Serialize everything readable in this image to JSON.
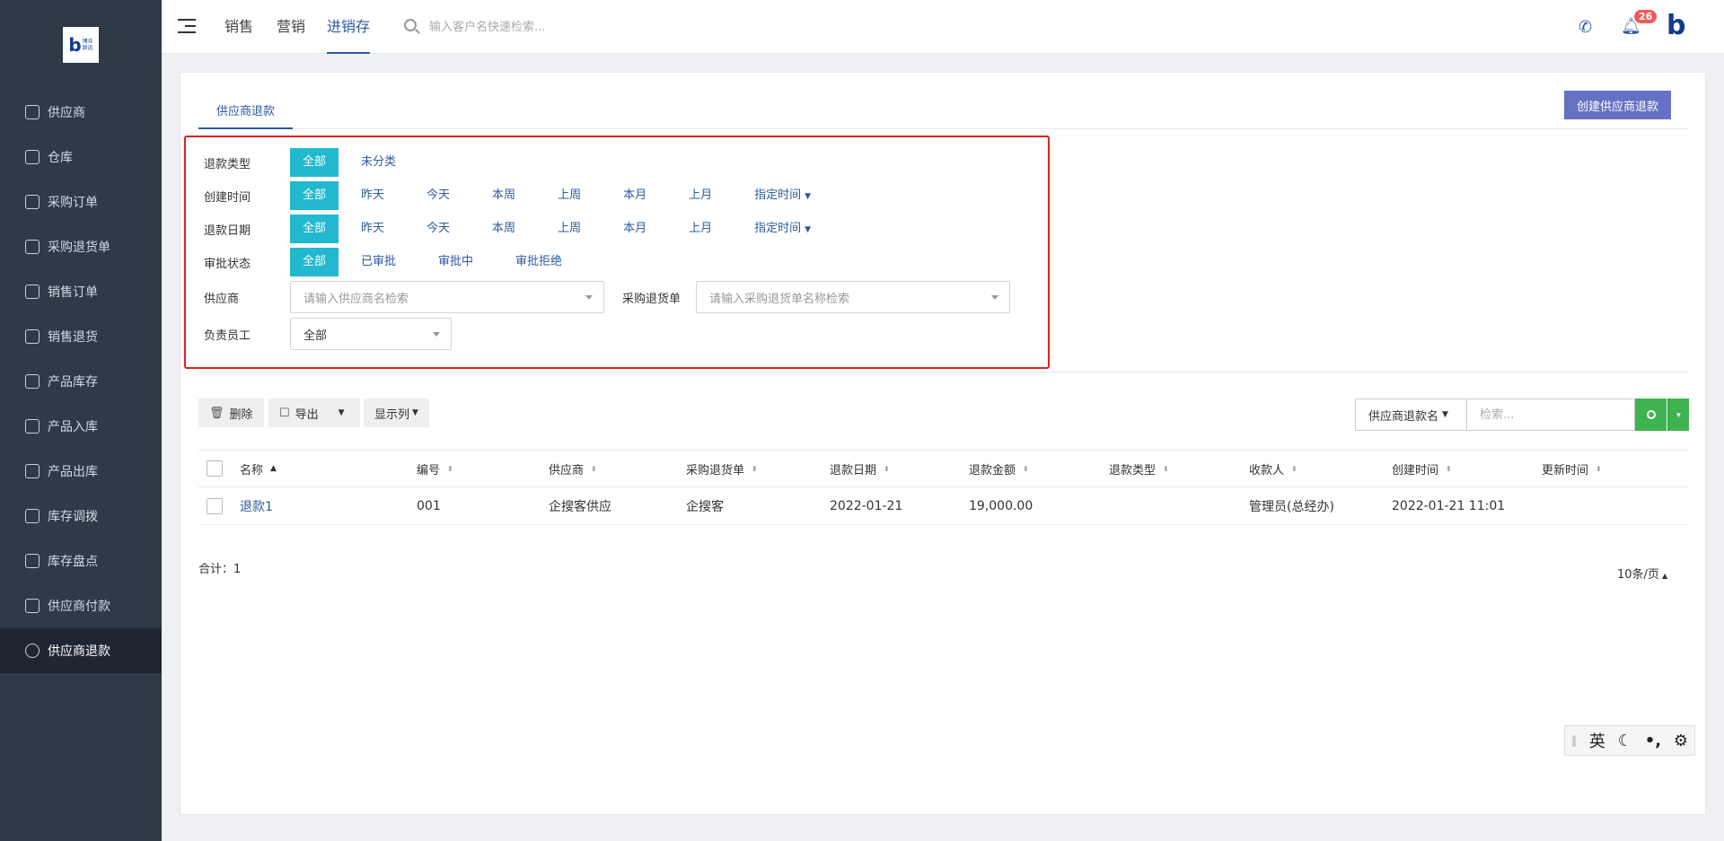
{
  "logo": {
    "letter": "b",
    "text": "博众\n致远"
  },
  "sidebar": {
    "items": [
      {
        "label": "供应商",
        "icon": "store-icon"
      },
      {
        "label": "仓库",
        "icon": "warehouse-icon"
      },
      {
        "label": "采购订单",
        "icon": "cart-icon"
      },
      {
        "label": "采购退货单",
        "icon": "cart-return-icon"
      },
      {
        "label": "销售订单",
        "icon": "document-icon"
      },
      {
        "label": "销售退货",
        "icon": "return-document-icon"
      },
      {
        "label": "产品库存",
        "icon": "inventory-icon"
      },
      {
        "label": "产品入库",
        "icon": "stock-in-icon"
      },
      {
        "label": "产品出库",
        "icon": "stock-out-icon"
      },
      {
        "label": "库存调拨",
        "icon": "transfer-icon"
      },
      {
        "label": "库存盘点",
        "icon": "stocktake-icon"
      },
      {
        "label": "供应商付款",
        "icon": "money-bag-icon"
      },
      {
        "label": "供应商退款",
        "icon": "refund-icon",
        "active": true
      }
    ]
  },
  "header": {
    "tabs": [
      "销售",
      "营销",
      "进销存"
    ],
    "active_tab": "进销存",
    "search_placeholder": "输入客户名快速检索...",
    "notification_count": "26",
    "brand_letter": "b"
  },
  "page": {
    "tab": "供应商退款",
    "create_button": "创建供应商退款"
  },
  "filters": {
    "refund_type": {
      "label": "退款类型",
      "options": [
        "全部",
        "未分类"
      ]
    },
    "created_time": {
      "label": "创建时间",
      "options": [
        "全部",
        "昨天",
        "今天",
        "本周",
        "上周",
        "本月",
        "上月",
        "指定时间"
      ]
    },
    "refund_date": {
      "label": "退款日期",
      "options": [
        "全部",
        "昨天",
        "今天",
        "本周",
        "上周",
        "本月",
        "上月",
        "指定时间"
      ]
    },
    "approval_status": {
      "label": "审批状态",
      "options": [
        "全部",
        "已审批",
        "审批中",
        "审批拒绝"
      ]
    },
    "supplier": {
      "label": "供应商",
      "placeholder": "请输入供应商名检索"
    },
    "purchase_return": {
      "label": "采购退货单",
      "placeholder": "请输入采购退货单名称检索"
    },
    "staff": {
      "label": "负责员工",
      "value": "全部"
    }
  },
  "toolbar": {
    "delete_label": "删除",
    "export_label": "导出",
    "columns_label": "显示列",
    "search_field": "供应商退款名",
    "search_placeholder": "检索..."
  },
  "table": {
    "columns": [
      "名称",
      "编号",
      "供应商",
      "采购退货单",
      "退款日期",
      "退款金额",
      "退款类型",
      "收款人",
      "创建时间",
      "更新时间"
    ],
    "rows": [
      {
        "name": "退款1",
        "code": "001",
        "supplier": "企搜客供应",
        "purchase_return": "企搜客",
        "refund_date": "2022-01-21",
        "amount": "19,000.00",
        "type": "",
        "payee": "管理员(总经办)",
        "created": "2022-01-21 11:01",
        "updated": ""
      }
    ]
  },
  "footer": {
    "total": "合计：1",
    "page_size": "10条/页"
  },
  "ime": {
    "mode": "英"
  },
  "colors": {
    "sidebar": "#2e3a48",
    "accent": "#2d5b9e",
    "selected": "#22b8cf",
    "create": "#6572c4",
    "search_green": "#3fb34f",
    "highlight": "#e02020"
  }
}
